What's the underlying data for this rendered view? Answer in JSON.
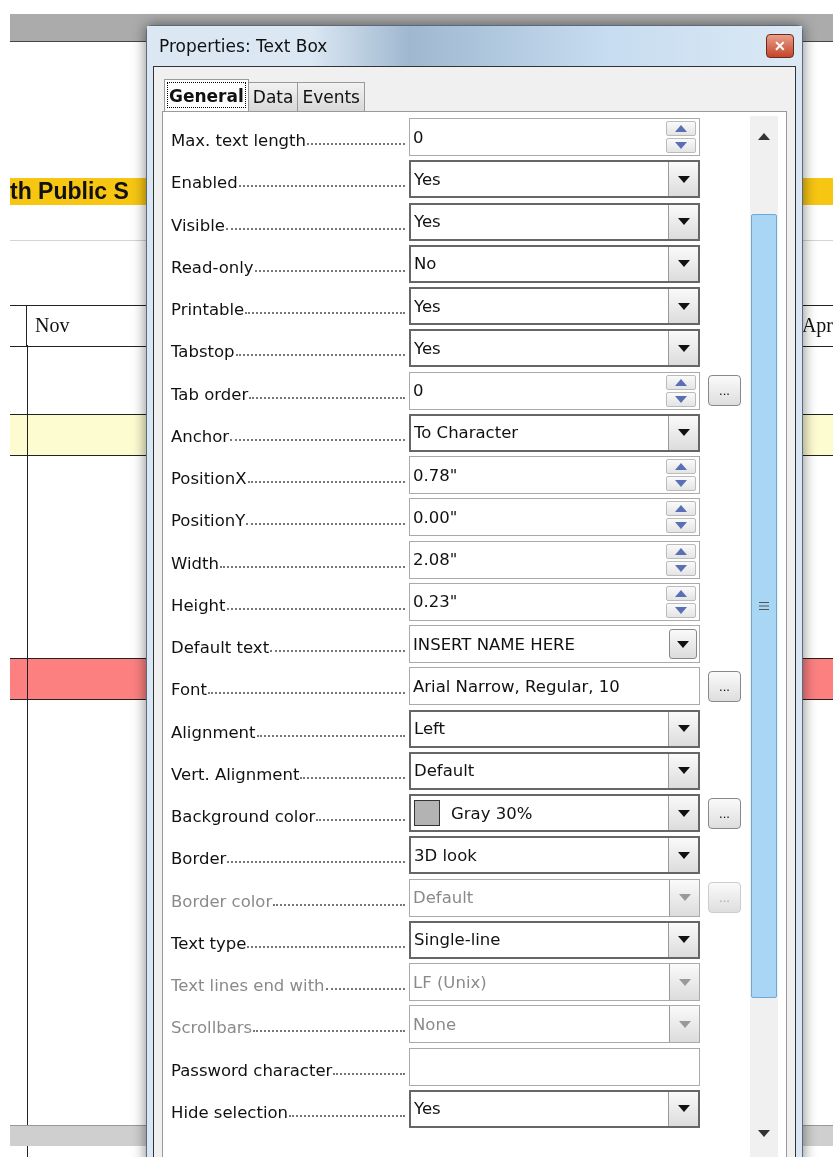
{
  "document": {
    "heading_left": "th Public S",
    "column_left": "Nov",
    "column_right": "Apr"
  },
  "dialog": {
    "title": "Properties: Text Box",
    "close": "✕",
    "tabs": [
      {
        "label": "General",
        "selected": true
      },
      {
        "label": "Data",
        "selected": false
      },
      {
        "label": "Events",
        "selected": false
      }
    ],
    "rows": [
      {
        "label": "Max. text length",
        "kind": "spin",
        "value": "0",
        "disabled": false
      },
      {
        "label": "Enabled",
        "kind": "select",
        "value": "Yes",
        "disabled": false
      },
      {
        "label": "Visible",
        "kind": "select",
        "value": "Yes",
        "disabled": false
      },
      {
        "label": "Read-only",
        "kind": "select",
        "value": "No",
        "disabled": false
      },
      {
        "label": "Printable",
        "kind": "select",
        "value": "Yes",
        "disabled": false
      },
      {
        "label": "Tabstop",
        "kind": "select",
        "value": "Yes",
        "disabled": false
      },
      {
        "label": "Tab order",
        "kind": "spin",
        "value": "0",
        "disabled": false,
        "button": "..."
      },
      {
        "label": "Anchor",
        "kind": "select",
        "value": "To Character",
        "disabled": false
      },
      {
        "label": "PositionX",
        "kind": "spin",
        "value": "0.78\"",
        "disabled": false
      },
      {
        "label": "PositionY",
        "kind": "spin",
        "value": "0.00\"",
        "disabled": false
      },
      {
        "label": "Width",
        "kind": "spin",
        "value": "2.08\"",
        "disabled": false
      },
      {
        "label": "Height",
        "kind": "spin",
        "value": "0.23\"",
        "disabled": false
      },
      {
        "label": "Default text",
        "kind": "combo",
        "value": "INSERT NAME HERE",
        "disabled": false
      },
      {
        "label": "Font",
        "kind": "text",
        "value": "Arial Narrow, Regular, 10",
        "disabled": false,
        "button": "..."
      },
      {
        "label": "Alignment",
        "kind": "select",
        "value": "Left",
        "disabled": false
      },
      {
        "label": "Vert. Alignment",
        "kind": "select",
        "value": "Default",
        "disabled": false
      },
      {
        "label": "Background color",
        "kind": "color",
        "value": "Gray 30%",
        "color": "#b3b3b3",
        "disabled": false,
        "button": "..."
      },
      {
        "label": "Border",
        "kind": "select",
        "value": "3D look",
        "disabled": false
      },
      {
        "label": "Border color",
        "kind": "select",
        "value": "Default",
        "disabled": true,
        "button": "..."
      },
      {
        "label": "Text type",
        "kind": "select",
        "value": "Single-line",
        "disabled": false
      },
      {
        "label": "Text lines end with",
        "kind": "select",
        "value": "LF (Unix)",
        "disabled": true
      },
      {
        "label": "Scrollbars",
        "kind": "select",
        "value": "None",
        "disabled": true
      },
      {
        "label": "Password character",
        "kind": "text",
        "disabled": false
      },
      {
        "label": "Hide selection",
        "kind": "select",
        "value": "Yes",
        "disabled": false
      }
    ]
  }
}
